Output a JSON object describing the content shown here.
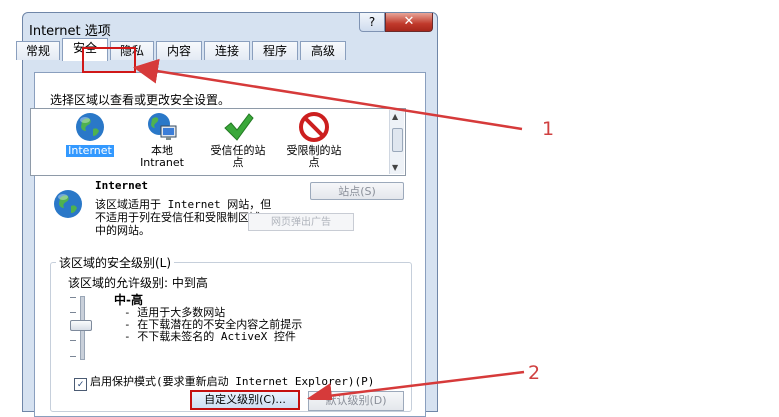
{
  "window": {
    "title": "Internet 选项",
    "help_button": "?",
    "close_button": "✕"
  },
  "tabs": [
    {
      "label": "常规"
    },
    {
      "label": "安全"
    },
    {
      "label": "隐私"
    },
    {
      "label": "内容"
    },
    {
      "label": "连接"
    },
    {
      "label": "程序"
    },
    {
      "label": "高级"
    }
  ],
  "active_tab": "安全",
  "zone_prompt": "选择区域以查看或更改安全设置。",
  "zones": [
    {
      "label": "Internet",
      "icon": "globe-icon",
      "selected": true
    },
    {
      "label": "本地\nIntranet",
      "icon": "intranet-globe-icon",
      "selected": false
    },
    {
      "label": "受信任的站\n点",
      "icon": "checkmark-icon",
      "selected": false
    },
    {
      "label": "受限制的站\n点",
      "icon": "prohibited-icon",
      "selected": false
    }
  ],
  "zone_info": {
    "title": "Internet",
    "description": "该区域适用于 Internet 网站，但\n不适用于列在受信任和受限制区域\n中的网站。",
    "sites_button": "站点(S)",
    "tooltip": "网页弹出广告"
  },
  "security_level": {
    "group_label": "该区域的安全级别(L)",
    "allowed": "该区域的允许级别: 中到高",
    "level_name": "中-高",
    "bullets": [
      "- 适用于大多数网站",
      "- 在下载潜在的不安全内容之前提示",
      "- 不下载未签名的 ActiveX 控件"
    ]
  },
  "protected_mode": {
    "label": "启用保护模式(要求重新启动 Internet Explorer)(P)",
    "checked": true
  },
  "buttons": {
    "custom": "自定义级别(C)...",
    "default": "默认级别(D)"
  },
  "annotations": {
    "label_1": "1",
    "label_2": "2",
    "color": "#d04040"
  }
}
